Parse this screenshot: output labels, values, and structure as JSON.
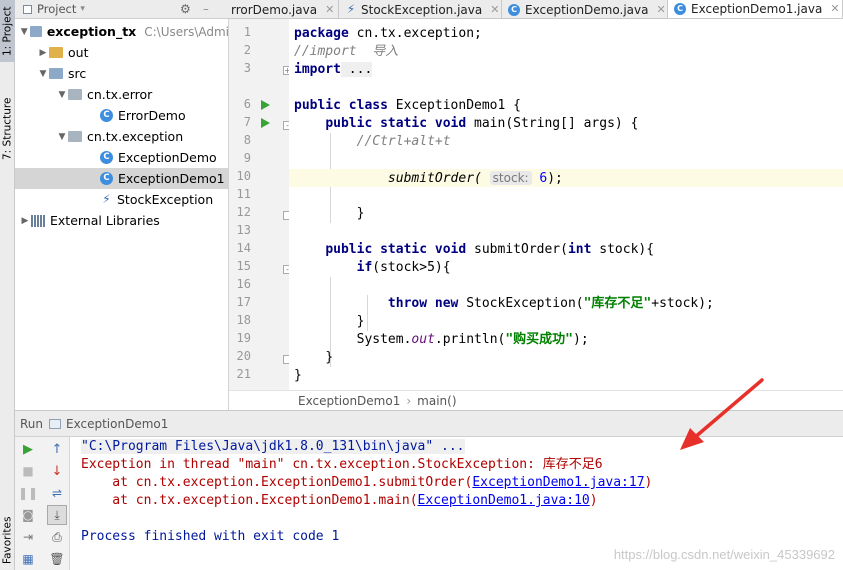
{
  "sidebar": {
    "project_tab": "1: Project",
    "structure_tab": "7: Structure",
    "favorites_tab": "Favorites"
  },
  "project": {
    "header": "Project",
    "tree": [
      {
        "label": "exception_tx",
        "path": "C:\\Users\\Admi",
        "kind": "module"
      },
      {
        "label": "out",
        "kind": "folder-yellow"
      },
      {
        "label": "src",
        "kind": "folder"
      },
      {
        "label": "cn.tx.error",
        "kind": "package"
      },
      {
        "label": "ErrorDemo",
        "kind": "class"
      },
      {
        "label": "cn.tx.exception",
        "kind": "package"
      },
      {
        "label": "ExceptionDemo",
        "kind": "class-run"
      },
      {
        "label": "ExceptionDemo1",
        "kind": "class-run",
        "selected": true
      },
      {
        "label": "StockException",
        "kind": "exception-class"
      },
      {
        "label": "External Libraries",
        "kind": "library"
      }
    ]
  },
  "tabs": [
    {
      "label": "rrorDemo.java",
      "icon": "class-icon"
    },
    {
      "label": "StockException.java",
      "icon": "exception-class-icon"
    },
    {
      "label": "ExceptionDemo.java",
      "icon": "class-icon"
    },
    {
      "label": "ExceptionDemo1.java",
      "icon": "class-icon",
      "active": true
    }
  ],
  "editor": {
    "line_numbers": [
      "1",
      "2",
      "3",
      "6",
      "7",
      "8",
      "9",
      "10",
      "11",
      "12",
      "13",
      "14",
      "15",
      "16",
      "17",
      "18",
      "19",
      "20",
      "21"
    ],
    "code": {
      "l1_kw": "package",
      "l1_rest": " cn.tx.exception;",
      "l2": "//import  导入",
      "l3_kw": "import",
      "l3_rest": " ...",
      "l6_kw": "public class",
      "l6_rest": " ExceptionDemo1 {",
      "l7_kw": "public static void",
      "l7_rest": " main(String[] args) {",
      "l8": "//Ctrl+alt+t",
      "l10_call": "submitOrder(",
      "l10_hint": "stock:",
      "l10_num": "6",
      "l10_end": ");",
      "l12": "}",
      "l14_kw": "public static void",
      "l14_name": " submitOrder(",
      "l14_kw2": "int",
      "l14_rest": " stock){",
      "l15_kw": "if",
      "l15_rest": "(stock>5){",
      "l17_kw": "throw new",
      "l17_mid": " StockException(",
      "l17_str": "\"库存不足\"",
      "l17_end": "+stock);",
      "l18": "}",
      "l19_a": "System.",
      "l19_fld": "out",
      "l19_b": ".println(",
      "l19_str": "\"购买成功\"",
      "l19_end": ");",
      "l20": "}",
      "l21": "}"
    }
  },
  "breadcrumb": {
    "class": "ExceptionDemo1",
    "method": "main()"
  },
  "run": {
    "label": "Run",
    "config": "ExceptionDemo1",
    "console": {
      "cmd": "\"C:\\Program Files\\Java\\jdk1.8.0_131\\bin\\java\" ...",
      "exc": "Exception in thread \"main\" cn.tx.exception.StockException: 库存不足6",
      "at1_pre": "    at cn.tx.exception.ExceptionDemo1.submitOrder(",
      "at1_link": "ExceptionDemo1.java:17",
      "at1_post": ")",
      "at2_pre": "    at cn.tx.exception.ExceptionDemo1.main(",
      "at2_link": "ExceptionDemo1.java:10",
      "at2_post": ")",
      "exit": "Process finished with exit code 1"
    }
  },
  "watermark": "https://blog.csdn.net/weixin_45339692",
  "colors": {
    "annotation_arrow": "#e8302a",
    "keyword": "#000080",
    "string": "#008000",
    "error": "#b00000",
    "link": "#0000ee"
  }
}
